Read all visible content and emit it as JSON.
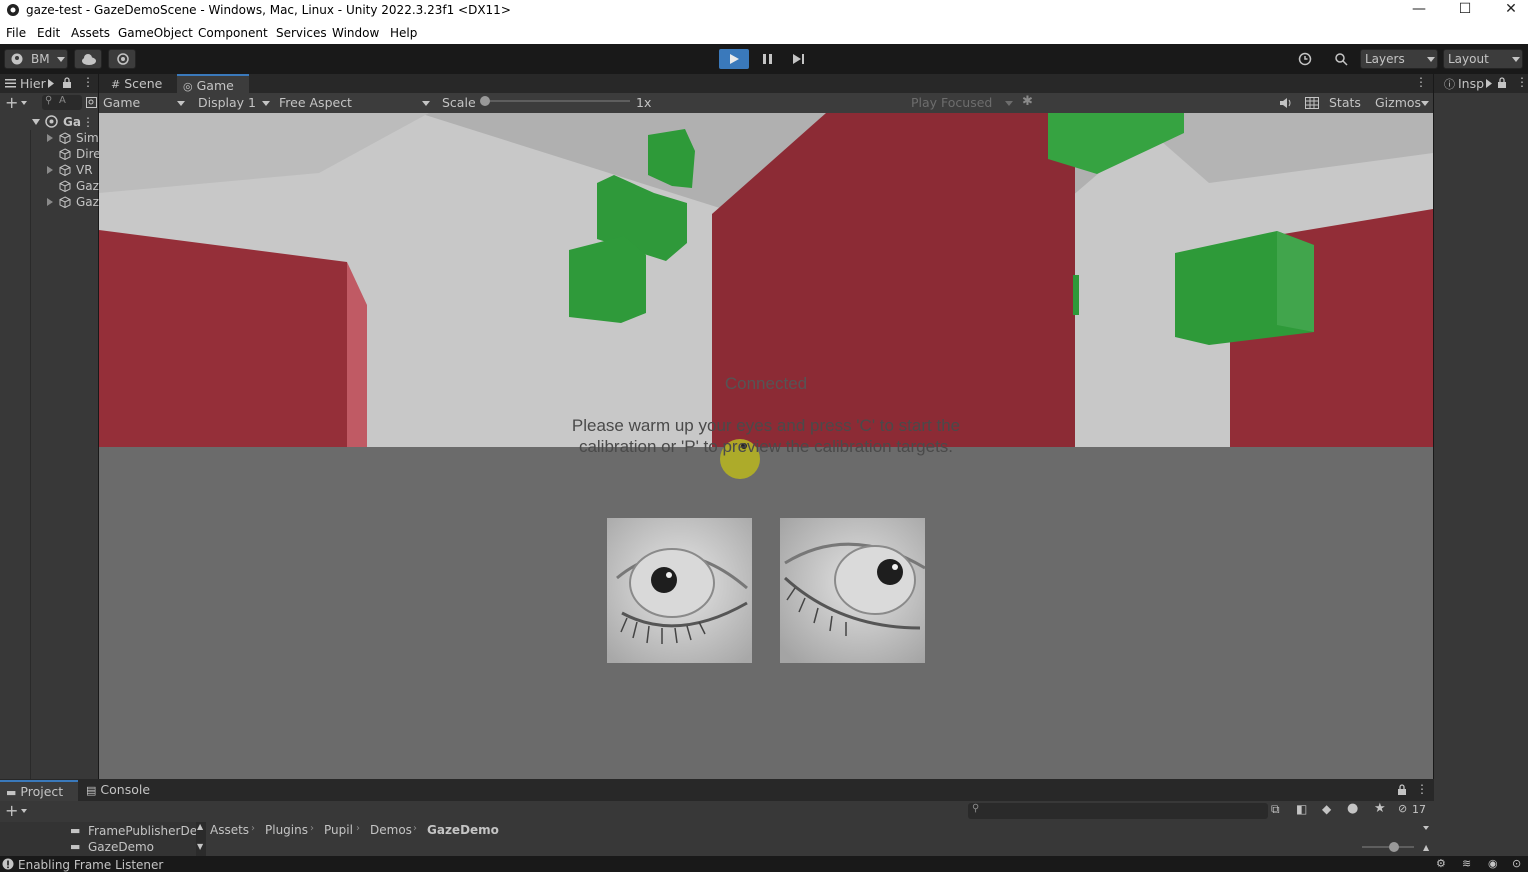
{
  "window": {
    "title": "gaze-test - GazeDemoScene - Windows, Mac, Linux - Unity 2022.3.23f1 <DX11>",
    "minimize": "—",
    "maximize": "☐",
    "close": "✕"
  },
  "menu": [
    "File",
    "Edit",
    "Assets",
    "GameObject",
    "Component",
    "Services",
    "Window",
    "Help"
  ],
  "toolbar": {
    "account_label": "BM",
    "layers_label": "Layers",
    "layout_label": "Layout"
  },
  "hierarchy": {
    "tab_label": "Hier",
    "search_placeholder": "A",
    "scene_label": "Ga",
    "items": [
      "Sim",
      "Dire",
      "VR",
      "Gaz",
      "Gaz"
    ]
  },
  "scene_tabs": {
    "scene": "Scene",
    "game": "Game"
  },
  "game_toolbar": {
    "mode": "Game",
    "display": "Display 1",
    "aspect": "Free Aspect",
    "scale_label": "Scale",
    "scale_value": "1x",
    "play_focused": "Play Focused",
    "stats": "Stats",
    "gizmos": "Gizmos"
  },
  "inspector": {
    "tab_label": "Insp"
  },
  "game_overlay": {
    "status": "Connected",
    "instruction_line1": "Please warm up your eyes and press 'C' to start the",
    "instruction_line2": "calibration or 'P' to preview the calibration targets."
  },
  "bottom_panel": {
    "project_tab": "Project",
    "console_tab": "Console",
    "folders": [
      "FramePublisherDe",
      "GazeDemo"
    ],
    "breadcrumb": [
      "Assets",
      "Plugins",
      "Pupil",
      "Demos",
      "GazeDemo"
    ],
    "hidden_count": "17"
  },
  "status_bar": {
    "message": "Enabling Frame Listener"
  },
  "colors": {
    "play_active": "#3a79bb",
    "red_wall": "#8f2d35",
    "green_cube": "#2f9a3a",
    "gaze_dot": "#b5b223"
  }
}
